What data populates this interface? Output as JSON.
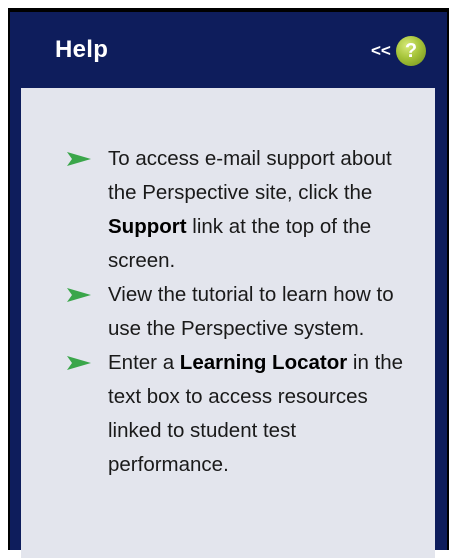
{
  "panel": {
    "title": "Help",
    "collapse_label": "<<",
    "help_icon_label": "?"
  },
  "tips": [
    {
      "before": "To access e-mail support about the Perspective site, click the ",
      "bold": "Support",
      "after": " link at the top of the screen."
    },
    {
      "before": "View the tutorial to learn how to use the Perspective system.",
      "bold": "",
      "after": ""
    },
    {
      "before": "Enter a ",
      "bold": "Learning Locator",
      "after": " in the text box to access resources linked to student test performance."
    }
  ],
  "icons": {
    "bullet": "arrow-right-icon",
    "help": "help-icon"
  },
  "colors": {
    "header_bg": "#0e1d5c",
    "content_bg": "#e3e5ed",
    "arrow": "#3aa64a",
    "help_icon": "#a6c43a"
  }
}
